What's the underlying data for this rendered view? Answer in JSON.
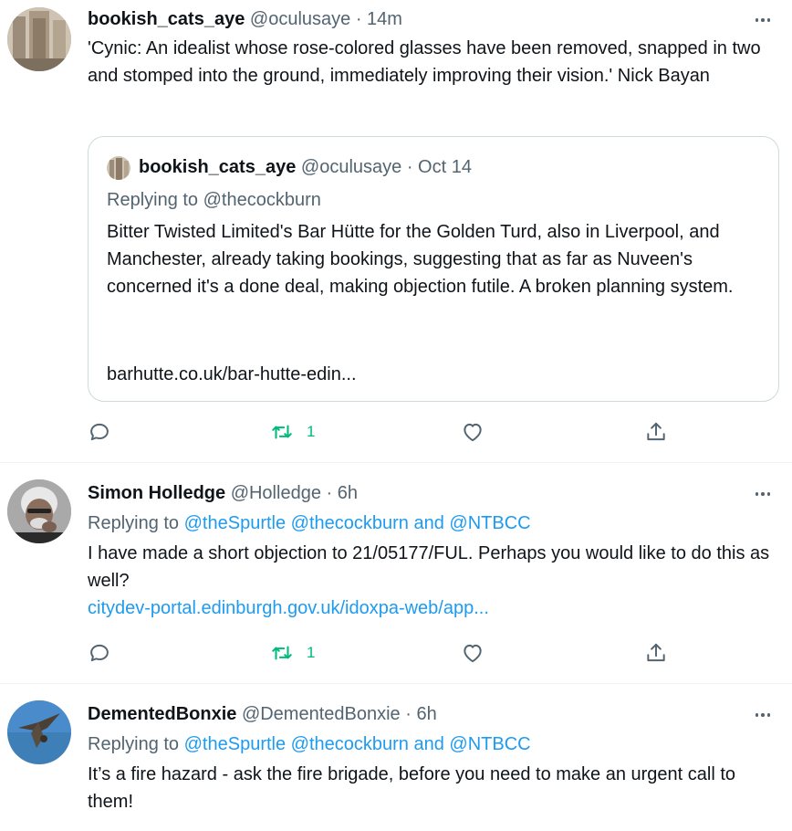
{
  "tweets": [
    {
      "name": "bookish_cats_aye",
      "handle": "@oculusaye",
      "time": "· 14m",
      "text": "'Cynic: An idealist whose rose-colored glasses have been removed, snapped in two and stomped into the ground, immediately improving their vision.' Nick Bayan",
      "quote": {
        "name": "bookish_cats_aye",
        "handle": "@oculusaye",
        "time": "· Oct 14",
        "replying_label": "Replying to",
        "replying_to": "@thecockburn",
        "text": "Bitter Twisted Limited's Bar Hütte for the Golden Turd, also in Liverpool, and Manchester, already taking bookings, suggesting that as far as Nuveen's concerned it's a done deal, making objection futile. A broken planning system.",
        "url": "barhutte.co.uk/bar-hutte-edin..."
      },
      "retweets": "1"
    },
    {
      "name": "Simon Holledge",
      "handle": "@Holledge",
      "time": "· 6h",
      "replying_label": "Replying to",
      "replying_to": "@theSpurtle @thecockburn and @NTBCC",
      "text": "I have made a short objection to 21/05177/FUL. Perhaps you would like to do this as well?",
      "link": "citydev-portal.edinburgh.gov.uk/idoxpa-web/app...",
      "retweets": "1"
    },
    {
      "name": "DementedBonxie",
      "handle": "@DementedBonxie",
      "time": "· 6h",
      "replying_label": "Replying to",
      "replying_to": "@theSpurtle @thecockburn and @NTBCC",
      "text": "It’s a fire hazard - ask the fire brigade, before you need to make an urgent call to them!"
    }
  ],
  "icons": {
    "reply": "reply-icon",
    "retweet": "retweet-icon",
    "like": "heart-icon",
    "share": "share-icon",
    "more": "more-icon"
  },
  "colors": {
    "text": "#0f1419",
    "secondary": "#536471",
    "link": "#1d9bf0",
    "retweet": "#00ba7c",
    "border": "#cfd9de"
  }
}
